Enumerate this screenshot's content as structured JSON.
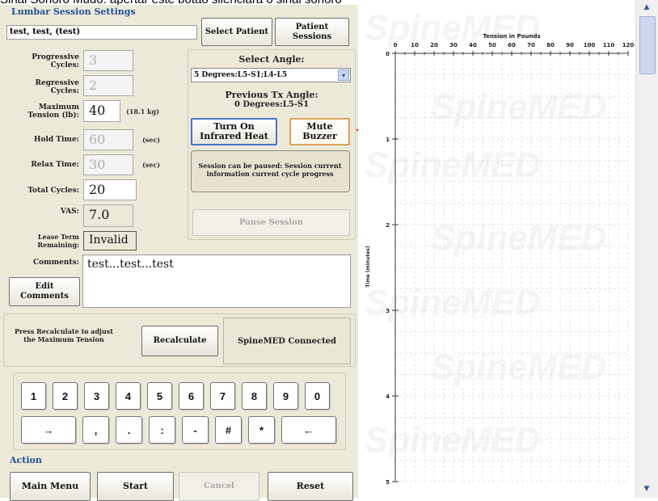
{
  "caption": "Sinal Sonoro Mudo: apertar este botão silenciará o sinal sonoro",
  "section_title": "Lumbar Session Settings",
  "patient_name": "test, test, (test)",
  "buttons": {
    "select_patient": "Select Patient",
    "patient_sessions": "Patient Sessions",
    "turn_on_infrared": "Turn On Infrared Heat",
    "mute_buzzer": "Mute Buzzer",
    "pause_session": "Pause Session",
    "edit_comments": "Edit Comments",
    "recalculate": "Recalculate",
    "main_menu": "Main Menu",
    "start": "Start",
    "cancel": "Cancel",
    "reset": "Reset"
  },
  "settings": {
    "progressive_label": "Progressive Cycles:",
    "progressive_value": "3",
    "regressive_label": "Regressive Cycles:",
    "regressive_value": "2",
    "max_tension_label": "Maximum Tension (lb):",
    "max_tension_value": "40",
    "max_tension_kg": "(18.1 kg)",
    "hold_label": "Hold Time:",
    "hold_value": "60",
    "hold_unit": "(sec)",
    "relax_label": "Relax Time:",
    "relax_value": "30",
    "relax_unit": "(sec)",
    "total_label": "Total Cycles:",
    "total_value": "20",
    "vas_label": "VAS:",
    "vas_value": "7.0",
    "lease_label": "Lease Term Remaining:",
    "lease_value": "Invalid",
    "comments_label": "Comments:",
    "comments_value": "test...test...test"
  },
  "angle": {
    "select_label": "Select Angle:",
    "selected": "5 Degrees:L5-S1;L4-L5",
    "previous_label": "Previous Tx Angle:",
    "previous_value": "0 Degrees:L5-S1"
  },
  "session_info": "Session can be paused: Session current information current cycle progress",
  "recalc_note": "Press Recalculate to adjust the Maximum Tension",
  "connection_status": "SpineMED Connected",
  "keypad": {
    "row1": [
      "1",
      "2",
      "3",
      "4",
      "5",
      "6",
      "7",
      "8",
      "9",
      "0"
    ],
    "row2": [
      "→",
      ",",
      ".",
      ":",
      "-",
      "#",
      "*",
      "←"
    ]
  },
  "action_label": "Action",
  "watermark": "SpineMED",
  "chart_data": {
    "type": "line",
    "xlabel": "Tension in Pounds",
    "ylabel": "Time (minutes)",
    "x_ticks": [
      0,
      10,
      20,
      30,
      40,
      50,
      60,
      70,
      80,
      90,
      100,
      110,
      120
    ],
    "y_ticks": [
      0,
      1,
      2,
      3,
      4,
      5
    ],
    "xlim": [
      0,
      120
    ],
    "ylim": [
      0,
      5
    ],
    "grid": true,
    "series": []
  }
}
